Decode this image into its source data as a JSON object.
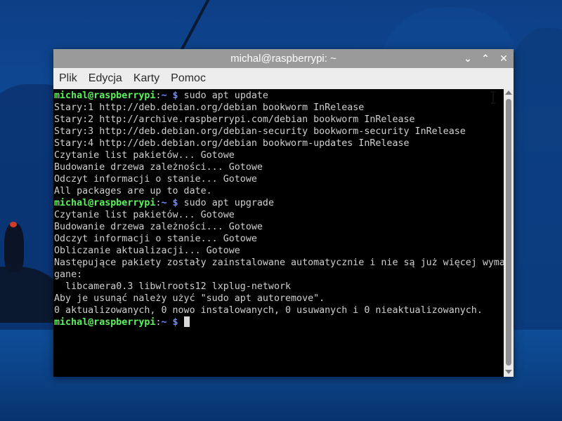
{
  "window": {
    "title": "michal@raspberrypi: ~",
    "controls": {
      "minimize_icon": "⌄",
      "maximize_icon": "⌃",
      "close_icon": "✕"
    }
  },
  "menu": {
    "items": [
      "Plik",
      "Edycja",
      "Karty",
      "Pomoc"
    ]
  },
  "terminal": {
    "prompt": {
      "user_host": "michal@raspberrypi",
      "sep": ":",
      "path": "~",
      "dollar": " $"
    },
    "lines": [
      {
        "type": "prompt",
        "cmd": " sudo apt update"
      },
      {
        "type": "out",
        "text": "Stary:1 http://deb.debian.org/debian bookworm InRelease"
      },
      {
        "type": "out",
        "text": "Stary:2 http://archive.raspberrypi.com/debian bookworm InRelease"
      },
      {
        "type": "out",
        "text": "Stary:3 http://deb.debian.org/debian-security bookworm-security InRelease"
      },
      {
        "type": "out",
        "text": "Stary:4 http://deb.debian.org/debian bookworm-updates InRelease"
      },
      {
        "type": "out",
        "text": "Czytanie list pakietów... Gotowe"
      },
      {
        "type": "out",
        "text": "Budowanie drzewa zależności... Gotowe"
      },
      {
        "type": "out",
        "text": "Odczyt informacji o stanie... Gotowe"
      },
      {
        "type": "out",
        "text": "All packages are up to date."
      },
      {
        "type": "prompt",
        "cmd": " sudo apt upgrade"
      },
      {
        "type": "out",
        "text": "Czytanie list pakietów... Gotowe"
      },
      {
        "type": "out",
        "text": "Budowanie drzewa zależności... Gotowe"
      },
      {
        "type": "out",
        "text": "Odczyt informacji o stanie... Gotowe"
      },
      {
        "type": "out",
        "text": "Obliczanie aktualizacji... Gotowe"
      },
      {
        "type": "out",
        "text": "Następujące pakiety zostały zainstalowane automatycznie i nie są już więcej wyma"
      },
      {
        "type": "out",
        "text": "gane:"
      },
      {
        "type": "out",
        "text": "  libcamera0.3 libwlroots12 lxplug-network"
      },
      {
        "type": "out",
        "text": "Aby je usunąć należy użyć \"sudo apt autoremove\"."
      },
      {
        "type": "out",
        "text": "0 aktualizowanych, 0 nowo instalowanych, 0 usuwanych i 0 nieaktualizowanych."
      },
      {
        "type": "prompt",
        "cmd": " ",
        "cursor": true
      }
    ]
  },
  "colors": {
    "prompt_user": "#5ef25e",
    "prompt_path": "#6f8bff",
    "text": "#cfcfcf",
    "titlebar": "#9a9a9a",
    "menubar": "#ededed"
  }
}
